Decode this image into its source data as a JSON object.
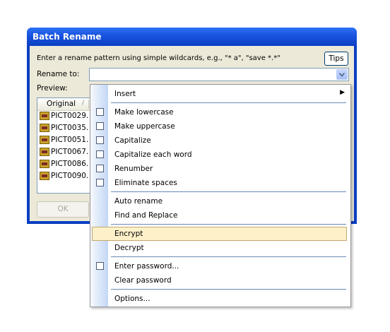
{
  "window": {
    "title": "Batch Rename",
    "instruction": "Enter a rename pattern using simple wildcards, e.g., \"* a\", \"save *.*\"",
    "tips_label": "Tips",
    "rename_label": "Rename to:",
    "rename_value": "",
    "preview_label": "Preview:",
    "list": {
      "column_header": "Original",
      "sort_indicator": "/",
      "rows": [
        "PICT0029.",
        "PICT0035.",
        "PICT0051.",
        "PICT0067.",
        "PICT0086.",
        "PICT0090."
      ]
    },
    "ok_label": "OK"
  },
  "menu": {
    "items": [
      {
        "label": "Insert",
        "submenu": true,
        "checkbox": false
      },
      {
        "label": "Make lowercase",
        "checkbox": true
      },
      {
        "label": "Make uppercase",
        "checkbox": true
      },
      {
        "label": "Capitalize",
        "checkbox": true
      },
      {
        "label": "Capitalize each word",
        "checkbox": true
      },
      {
        "label": "Renumber",
        "checkbox": true
      },
      {
        "label": "Eliminate spaces",
        "checkbox": true
      },
      {
        "label": "Auto rename",
        "checkbox": false
      },
      {
        "label": "Find and Replace",
        "checkbox": false
      },
      {
        "label": "Encrypt",
        "checkbox": false,
        "highlighted": true
      },
      {
        "label": "Decrypt",
        "checkbox": false
      },
      {
        "label": "Enter password...",
        "checkbox": true
      },
      {
        "label": "Clear password",
        "checkbox": false
      },
      {
        "label": "Options...",
        "checkbox": false
      }
    ],
    "submenu_arrow": "▶"
  },
  "colors": {
    "titlebar": "#0a3fc2",
    "dialog_face": "#ece9d8",
    "menu_highlight": "#fef1c9",
    "menu_highlight_border": "#c4a870"
  }
}
